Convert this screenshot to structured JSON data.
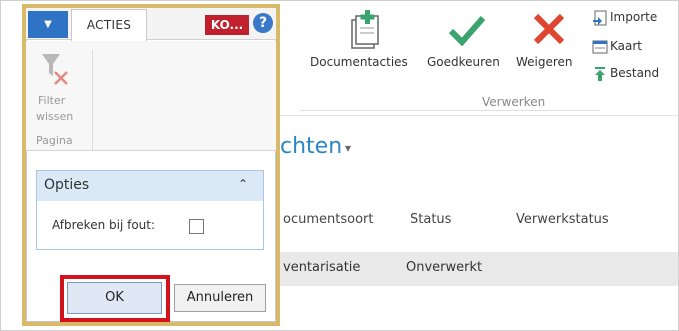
{
  "ribbon": {
    "buttons": [
      {
        "label": "Documentacties",
        "icon": "document-actions-icon"
      },
      {
        "label": "Goedkeuren",
        "icon": "checkmark-icon",
        "color": "#3aa46f"
      },
      {
        "label": "Weigeren",
        "icon": "x-mark-icon",
        "color": "#e0452f"
      }
    ],
    "side_items": [
      {
        "label": "Importe",
        "icon": "import-icon"
      },
      {
        "label": "Kaart",
        "icon": "card-icon"
      },
      {
        "label": "Bestand",
        "icon": "upload-arrow-icon"
      }
    ],
    "group_label": "Verwerken"
  },
  "page": {
    "heading": "chten",
    "columns": [
      "ocumentsoort",
      "Status",
      "Verwerkstatus"
    ],
    "row": [
      "ventarisatie",
      "Onverwerkt"
    ]
  },
  "dialog": {
    "menu_icon": "dropdown-arrow-icon",
    "tab_label": "ACTIES",
    "company_badge": "KO...",
    "help_symbol": "?",
    "filter_label_1": "Filter",
    "filter_label_2": "wissen",
    "group_label": "Pagina",
    "section_title": "Opties",
    "option_label": "Afbreken bij fout:",
    "option_checked": false,
    "ok_label": "OK",
    "cancel_label": "Annuleren",
    "accent_color": "#2e73c4",
    "highlight_color": "#d3121c"
  }
}
